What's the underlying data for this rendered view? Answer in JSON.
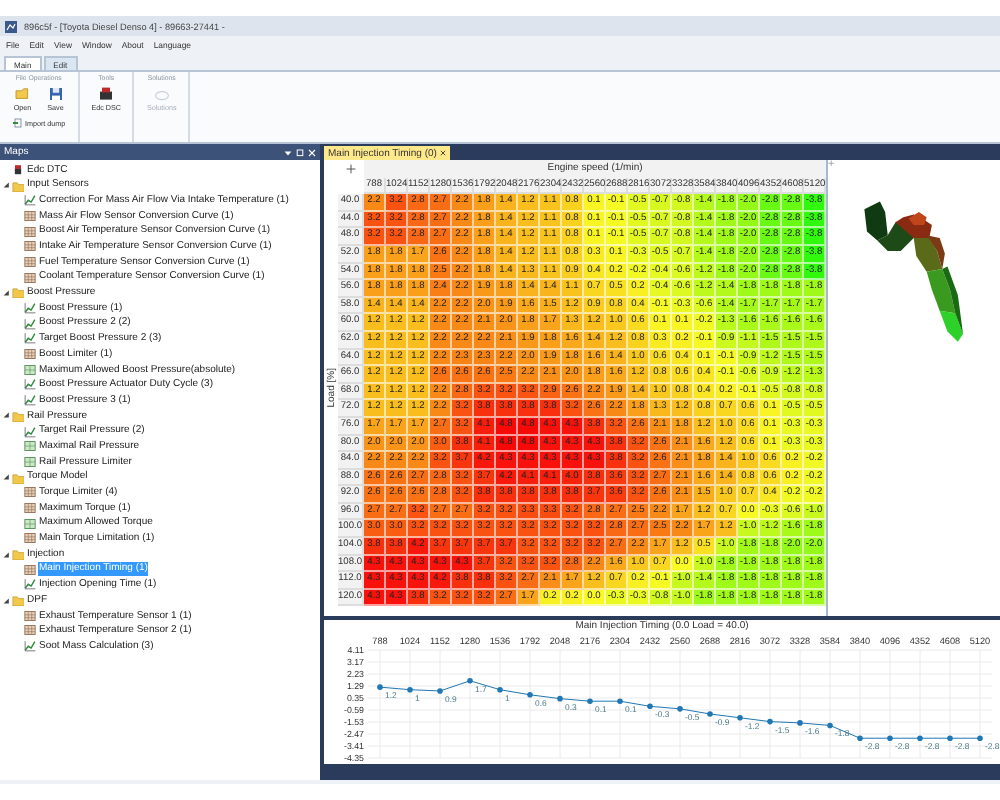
{
  "window": {
    "title": "896c5f - [Toyota Diesel Denso 4] - 89663-27441 -"
  },
  "menu": [
    "File",
    "Edit",
    "View",
    "Window",
    "About",
    "Language"
  ],
  "ribbon_tabs": [
    {
      "label": "Main",
      "selected": true
    },
    {
      "label": "Edit",
      "selected": false
    }
  ],
  "ribbon_groups": [
    {
      "title": "File Operations",
      "buttons": [
        {
          "label": "Open",
          "kind": "open",
          "disabled": false
        },
        {
          "label": "Save",
          "kind": "save",
          "disabled": false
        },
        {
          "label": "Import dump",
          "kind": "import",
          "disabled": false
        }
      ]
    },
    {
      "title": "Tools",
      "buttons": [
        {
          "label": "Edc DSC",
          "kind": "dtc",
          "disabled": false
        }
      ]
    },
    {
      "title": "Solutions",
      "buttons": [
        {
          "label": "Solutions",
          "kind": "solutions",
          "disabled": true
        }
      ]
    }
  ],
  "maps_panel": {
    "title": "Maps",
    "tree": [
      {
        "label": "Edc DTC",
        "kind": "dtc",
        "selected": false
      },
      {
        "label": "Input Sensors",
        "kind": "folder",
        "expanded": true,
        "selected": false,
        "children": [
          {
            "label": "Correction For Mass Air Flow Via Intake Temperature (1)",
            "kind": "curve",
            "selected": false
          },
          {
            "label": "Mass Air Flow Sensor Conversion Curve (1)",
            "kind": "table",
            "selected": false
          },
          {
            "label": "Boost Air Temperature Sensor Conversion Curve (1)",
            "kind": "table",
            "selected": false
          },
          {
            "label": "Intake Air Temperature Sensor Conversion Curve (1)",
            "kind": "table",
            "selected": false
          },
          {
            "label": "Fuel Temperature Sensor Conversion Curve (1)",
            "kind": "table",
            "selected": false
          },
          {
            "label": "Coolant Temperature Sensor Conversion Curve (1)",
            "kind": "table",
            "selected": false
          }
        ]
      },
      {
        "label": "Boost Pressure",
        "kind": "folder",
        "expanded": true,
        "selected": false,
        "children": [
          {
            "label": "Boost Pressure (1)",
            "kind": "curve",
            "selected": false
          },
          {
            "label": "Boost Pressure 2 (2)",
            "kind": "curve",
            "selected": false
          },
          {
            "label": "Target Boost Pressure 2 (3)",
            "kind": "curve",
            "selected": false
          },
          {
            "label": "Boost Limiter (1)",
            "kind": "table",
            "selected": false
          },
          {
            "label": "Maximum Allowed Boost Pressure(absolute)",
            "kind": "grid",
            "selected": false
          },
          {
            "label": "Boost Pressure Actuator Duty Cycle (3)",
            "kind": "curve",
            "selected": false
          },
          {
            "label": "Boost Pressure 3 (1)",
            "kind": "curve",
            "selected": false
          }
        ]
      },
      {
        "label": "Rail Pressure",
        "kind": "folder",
        "expanded": true,
        "selected": false,
        "children": [
          {
            "label": "Target Rail Pressure (2)",
            "kind": "curve",
            "selected": false
          },
          {
            "label": "Maximal Rail Pressure",
            "kind": "grid",
            "selected": false
          },
          {
            "label": "Rail Pressure Limiter",
            "kind": "grid",
            "selected": false
          }
        ]
      },
      {
        "label": "Torque Model",
        "kind": "folder",
        "expanded": true,
        "selected": false,
        "children": [
          {
            "label": "Torque Limiter (4)",
            "kind": "table",
            "selected": false
          },
          {
            "label": "Maximum Torque (1)",
            "kind": "table",
            "selected": false
          },
          {
            "label": "Maximum Allowed Torque",
            "kind": "grid",
            "selected": false
          },
          {
            "label": "Main Torque Limitation (1)",
            "kind": "table",
            "selected": false
          }
        ]
      },
      {
        "label": "Injection",
        "kind": "folder",
        "expanded": true,
        "selected": false,
        "children": [
          {
            "label": "Main Injection Timing (1)",
            "kind": "table",
            "selected": true
          },
          {
            "label": "Injection Opening Time (1)",
            "kind": "curve",
            "selected": false
          }
        ]
      },
      {
        "label": "DPF",
        "kind": "folder",
        "expanded": true,
        "selected": false,
        "children": [
          {
            "label": "Exhaust Temperature Sensor 1 (1)",
            "kind": "table",
            "selected": false
          },
          {
            "label": "Exhaust Temperature Sensor 2 (1)",
            "kind": "table",
            "selected": false
          },
          {
            "label": "Soot Mass Calculation (3)",
            "kind": "curve",
            "selected": false
          }
        ]
      }
    ]
  },
  "document": {
    "tab": "Main Injection Timing (0)",
    "table": {
      "x_axis_title": "Engine speed (1/min)",
      "y_axis_title": "Load [%]",
      "columns": [
        "788",
        "1024",
        "1152",
        "1280",
        "1536",
        "1792",
        "2048",
        "2176",
        "2304",
        "2432",
        "2560",
        "2688",
        "2816",
        "3072",
        "3328",
        "3584",
        "3840",
        "4096",
        "4352",
        "4608",
        "5120"
      ],
      "rows": [
        {
          "load": "40.0",
          "cells": [
            "2.2",
            "3.2",
            "2.8",
            "2.7",
            "2.2",
            "1.8",
            "1.4",
            "1.2",
            "1.1",
            "0.8",
            "0.1",
            "-0.1",
            "-0.5",
            "-0.7",
            "-0.8",
            "-1.4",
            "-1.8",
            "-2.0",
            "-2.8",
            "-2.8",
            "-3.8"
          ]
        },
        {
          "load": "44.0",
          "cells": [
            "3.2",
            "3.2",
            "2.8",
            "2.7",
            "2.2",
            "1.8",
            "1.4",
            "1.2",
            "1.1",
            "0.8",
            "0.1",
            "-0.1",
            "-0.5",
            "-0.7",
            "-0.8",
            "-1.4",
            "-1.8",
            "-2.0",
            "-2.8",
            "-2.8",
            "-3.8"
          ]
        },
        {
          "load": "48.0",
          "cells": [
            "3.2",
            "3.2",
            "2.8",
            "2.7",
            "2.2",
            "1.8",
            "1.4",
            "1.2",
            "1.1",
            "0.8",
            "0.1",
            "-0.1",
            "-0.5",
            "-0.7",
            "-0.8",
            "-1.4",
            "-1.8",
            "-2.0",
            "-2.8",
            "-2.8",
            "-3.8"
          ]
        },
        {
          "load": "52.0",
          "cells": [
            "1.8",
            "1.8",
            "1.7",
            "2.6",
            "2.2",
            "1.8",
            "1.4",
            "1.2",
            "1.1",
            "0.8",
            "0.3",
            "0.1",
            "-0.3",
            "-0.5",
            "-0.7",
            "-1.4",
            "-1.8",
            "-2.0",
            "-2.8",
            "-2.8",
            "-3.8"
          ]
        },
        {
          "load": "54.0",
          "cells": [
            "1.8",
            "1.8",
            "1.8",
            "2.5",
            "2.2",
            "1.8",
            "1.4",
            "1.3",
            "1.1",
            "0.9",
            "0.4",
            "0.2",
            "-0.2",
            "-0.4",
            "-0.6",
            "-1.2",
            "-1.8",
            "-2.0",
            "-2.8",
            "-2.8",
            "-3.8"
          ]
        },
        {
          "load": "56.0",
          "cells": [
            "1.8",
            "1.8",
            "1.8",
            "2.4",
            "2.2",
            "1.9",
            "1.8",
            "1.4",
            "1.4",
            "1.1",
            "0.7",
            "0.5",
            "0.2",
            "-0.4",
            "-0.6",
            "-1.2",
            "-1.4",
            "-1.8",
            "-1.8",
            "-1.8",
            "-1.8"
          ]
        },
        {
          "load": "58.0",
          "cells": [
            "1.4",
            "1.4",
            "1.4",
            "2.2",
            "2.2",
            "2.0",
            "1.9",
            "1.6",
            "1.5",
            "1.2",
            "0.9",
            "0.8",
            "0.4",
            "-0.1",
            "-0.3",
            "-0.6",
            "-1.4",
            "-1.7",
            "-1.7",
            "-1.7",
            "-1.7"
          ]
        },
        {
          "load": "60.0",
          "cells": [
            "1.2",
            "1.2",
            "1.2",
            "2.2",
            "2.2",
            "2.1",
            "2.0",
            "1.8",
            "1.7",
            "1.3",
            "1.2",
            "1.0",
            "0.6",
            "0.1",
            "0.1",
            "-0.2",
            "-1.3",
            "-1.6",
            "-1.6",
            "-1.6",
            "-1.6"
          ]
        },
        {
          "load": "62.0",
          "cells": [
            "1.2",
            "1.2",
            "1.2",
            "2.2",
            "2.2",
            "2.2",
            "2.1",
            "1.9",
            "1.8",
            "1.6",
            "1.4",
            "1.2",
            "0.8",
            "0.3",
            "0.2",
            "-0.1",
            "-0.9",
            "-1.1",
            "-1.5",
            "-1.5",
            "-1.5"
          ]
        },
        {
          "load": "64.0",
          "cells": [
            "1.2",
            "1.2",
            "1.2",
            "2.2",
            "2.3",
            "2.3",
            "2.2",
            "2.0",
            "1.9",
            "1.8",
            "1.6",
            "1.4",
            "1.0",
            "0.6",
            "0.4",
            "0.1",
            "-0.1",
            "-0.9",
            "-1.2",
            "-1.5",
            "-1.5"
          ]
        },
        {
          "load": "66.0",
          "cells": [
            "1.2",
            "1.2",
            "1.2",
            "2.6",
            "2.6",
            "2.6",
            "2.5",
            "2.2",
            "2.1",
            "2.0",
            "1.8",
            "1.6",
            "1.2",
            "0.8",
            "0.6",
            "0.4",
            "-0.1",
            "-0.6",
            "-0.9",
            "-1.2",
            "-1.3"
          ]
        },
        {
          "load": "68.0",
          "cells": [
            "1.2",
            "1.2",
            "1.2",
            "2.2",
            "2.8",
            "3.2",
            "3.2",
            "3.2",
            "2.9",
            "2.6",
            "2.2",
            "1.9",
            "1.4",
            "1.0",
            "0.8",
            "0.4",
            "0.2",
            "-0.1",
            "-0.5",
            "-0.8",
            "-0.8"
          ]
        },
        {
          "load": "72.0",
          "cells": [
            "1.2",
            "1.2",
            "1.2",
            "2.2",
            "3.2",
            "3.8",
            "3.8",
            "3.8",
            "3.8",
            "3.2",
            "2.6",
            "2.2",
            "1.8",
            "1.3",
            "1.2",
            "0.8",
            "0.7",
            "0.6",
            "0.1",
            "-0.5",
            "-0.5"
          ]
        },
        {
          "load": "76.0",
          "cells": [
            "1.7",
            "1.7",
            "1.7",
            "2.7",
            "3.2",
            "4.1",
            "4.8",
            "4.8",
            "4.3",
            "4.3",
            "3.8",
            "3.2",
            "2.6",
            "2.1",
            "1.8",
            "1.2",
            "1.0",
            "0.6",
            "0.1",
            "-0.3",
            "-0.3"
          ]
        },
        {
          "load": "80.0",
          "cells": [
            "2.0",
            "2.0",
            "2.0",
            "3.0",
            "3.8",
            "4.1",
            "4.8",
            "4.8",
            "4.3",
            "4.3",
            "4.3",
            "3.8",
            "3.2",
            "2.6",
            "2.1",
            "1.6",
            "1.2",
            "0.6",
            "0.1",
            "-0.3",
            "-0.3"
          ]
        },
        {
          "load": "84.0",
          "cells": [
            "2.2",
            "2.2",
            "2.2",
            "3.2",
            "3.7",
            "4.2",
            "4.3",
            "4.3",
            "4.3",
            "4.3",
            "4.3",
            "3.8",
            "3.2",
            "2.6",
            "2.1",
            "1.8",
            "1.4",
            "1.0",
            "0.6",
            "0.2",
            "-0.2"
          ]
        },
        {
          "load": "88.0",
          "cells": [
            "2.6",
            "2.6",
            "2.7",
            "2.8",
            "3.2",
            "3.7",
            "4.2",
            "4.1",
            "4.1",
            "4.0",
            "3.8",
            "3.6",
            "3.2",
            "2.7",
            "2.1",
            "1.6",
            "1.4",
            "0.8",
            "0.6",
            "0.2",
            "-0.2"
          ]
        },
        {
          "load": "92.0",
          "cells": [
            "2.6",
            "2.6",
            "2.6",
            "2.8",
            "3.2",
            "3.8",
            "3.8",
            "3.8",
            "3.8",
            "3.8",
            "3.7",
            "3.6",
            "3.2",
            "2.6",
            "2.1",
            "1.5",
            "1.0",
            "0.7",
            "0.4",
            "-0.2",
            "-0.2"
          ]
        },
        {
          "load": "96.0",
          "cells": [
            "2.7",
            "2.7",
            "3.2",
            "2.7",
            "2.7",
            "3.2",
            "3.2",
            "3.3",
            "3.3",
            "3.2",
            "2.8",
            "2.7",
            "2.5",
            "2.2",
            "1.7",
            "1.2",
            "0.7",
            "0.0",
            "-0.3",
            "-0.6",
            "-1.0"
          ]
        },
        {
          "load": "100.0",
          "cells": [
            "3.0",
            "3.0",
            "3.2",
            "3.2",
            "3.2",
            "3.2",
            "3.2",
            "3.2",
            "3.2",
            "3.2",
            "3.2",
            "2.8",
            "2.7",
            "2.5",
            "2.2",
            "1.7",
            "1.2",
            "-1.0",
            "-1.2",
            "-1.6",
            "-1.8"
          ]
        },
        {
          "load": "104.0",
          "cells": [
            "3.8",
            "3.8",
            "4.2",
            "3.7",
            "3.7",
            "3.7",
            "3.7",
            "3.2",
            "3.2",
            "3.2",
            "3.2",
            "2.7",
            "2.2",
            "1.7",
            "1.2",
            "0.5",
            "-1.0",
            "-1.8",
            "-1.8",
            "-2.0",
            "-2.0"
          ]
        },
        {
          "load": "108.0",
          "cells": [
            "4.3",
            "4.3",
            "4.3",
            "4.3",
            "4.3",
            "3.7",
            "3.2",
            "3.2",
            "3.2",
            "2.8",
            "2.2",
            "1.6",
            "1.0",
            "0.7",
            "0.0",
            "-1.0",
            "-1.8",
            "-1.8",
            "-1.8",
            "-1.8",
            "-1.8"
          ]
        },
        {
          "load": "112.0",
          "cells": [
            "4.3",
            "4.3",
            "4.3",
            "4.2",
            "3.8",
            "3.8",
            "3.2",
            "2.7",
            "2.1",
            "1.7",
            "1.2",
            "0.7",
            "0.2",
            "-0.1",
            "-1.0",
            "-1.4",
            "-1.8",
            "-1.8",
            "-1.8",
            "-1.8",
            "-1.8"
          ]
        },
        {
          "load": "120.0",
          "cells": [
            "4.3",
            "4.3",
            "3.8",
            "3.2",
            "3.2",
            "3.2",
            "2.7",
            "1.7",
            "0.2",
            "0.2",
            "0.0",
            "-0.3",
            "-0.3",
            "-0.8",
            "-1.0",
            "-1.8",
            "-1.8",
            "-1.8",
            "-1.8",
            "-1.8",
            "-1.8"
          ]
        }
      ]
    },
    "chart": {
      "chart_data": {
        "type": "line",
        "title": "Main Injection Timing (0.0 Load = 40.0)",
        "categories": [
          "788",
          "1024",
          "1152",
          "1280",
          "1536",
          "1792",
          "2048",
          "2176",
          "2304",
          "2432",
          "2560",
          "2688",
          "2816",
          "3072",
          "3328",
          "3584",
          "3840",
          "4096",
          "4352",
          "4608",
          "5120"
        ],
        "grid": true,
        "series": [
          {
            "color": "#1f77b4",
            "values": [
              1.2,
              1.0,
              0.9,
              1.7,
              1.0,
              0.6,
              0.3,
              0.1,
              0.1,
              -0.3,
              -0.5,
              -0.9,
              -1.2,
              -1.5,
              -1.6,
              -1.8,
              -2.8,
              -2.8,
              -2.8,
              -2.8,
              -2.8
            ]
          }
        ],
        "ylim": [
          -4.35,
          4.11
        ],
        "yticks": [
          4.11,
          3.17,
          2.23,
          1.29,
          0.35,
          -0.59,
          -1.53,
          -2.47,
          -3.41,
          -4.35
        ],
        "data_labels": true
      }
    }
  }
}
